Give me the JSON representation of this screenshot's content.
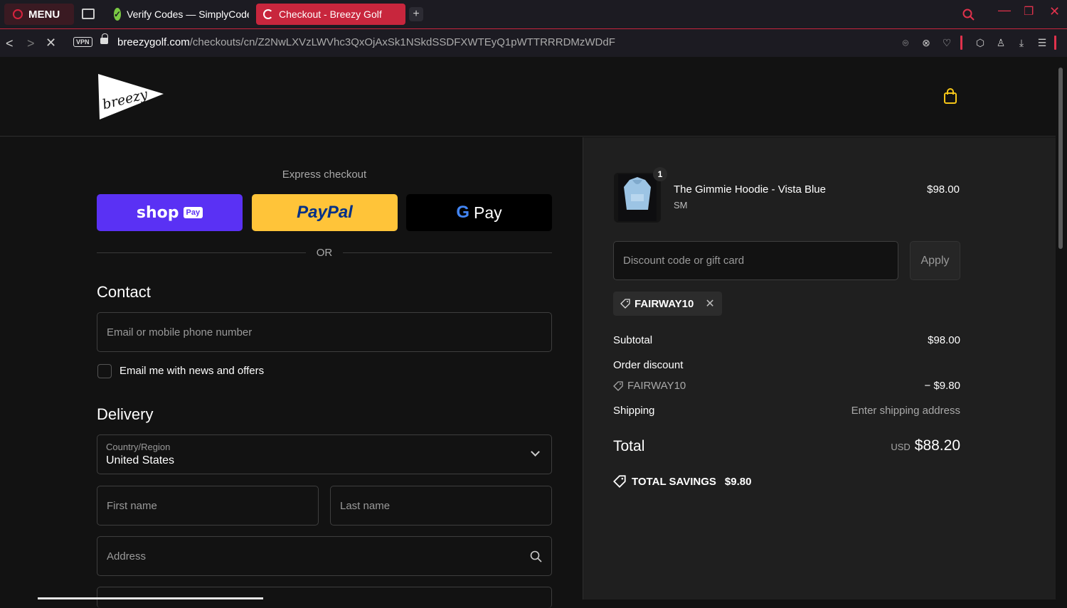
{
  "browser": {
    "menu_label": "MENU",
    "tabs": [
      {
        "title": "Verify Codes — SimplyCodes"
      },
      {
        "title": "Checkout - Breezy Golf"
      }
    ],
    "url_domain": "breezygolf.com",
    "url_path": "/checkouts/cn/Z2NwLXVzLWVhc3QxOjAxSk1NSkdSSDFXWTEyQ1pWTTRRRDMzWDdF",
    "vpn_label": "VPN"
  },
  "store": {
    "logo_text": "breezy"
  },
  "express": {
    "title": "Express checkout",
    "shop_label": "shop",
    "shop_pay_badge": "Pay",
    "paypal_label": "PayPal",
    "gpay_g": "G",
    "gpay_label": "Pay",
    "or_label": "OR"
  },
  "contact": {
    "heading": "Contact",
    "email_placeholder": "Email or mobile phone number",
    "newsletter_label": "Email me with news and offers"
  },
  "delivery": {
    "heading": "Delivery",
    "country_label": "Country/Region",
    "country_value": "United States",
    "first_name_placeholder": "First name",
    "last_name_placeholder": "Last name",
    "address_placeholder": "Address"
  },
  "summary": {
    "item": {
      "quantity": "1",
      "name": "The Gimmie Hoodie - Vista Blue",
      "variant": "SM",
      "price": "$98.00"
    },
    "discount_placeholder": "Discount code or gift card",
    "apply_label": "Apply",
    "applied_code": "FAIRWAY10",
    "subtotal_label": "Subtotal",
    "subtotal_value": "$98.00",
    "order_discount_label": "Order discount",
    "discount_code": "FAIRWAY10",
    "discount_value": "− $9.80",
    "shipping_label": "Shipping",
    "shipping_value": "Enter shipping address",
    "total_label": "Total",
    "total_currency": "USD",
    "total_value": "$88.20",
    "savings_label": "TOTAL SAVINGS",
    "savings_value": "$9.80"
  },
  "colors": {
    "accent_red": "#c8263d",
    "shop_purple": "#5a31f4",
    "paypal_yellow": "#ffc439",
    "cart_icon": "#f5c518"
  }
}
